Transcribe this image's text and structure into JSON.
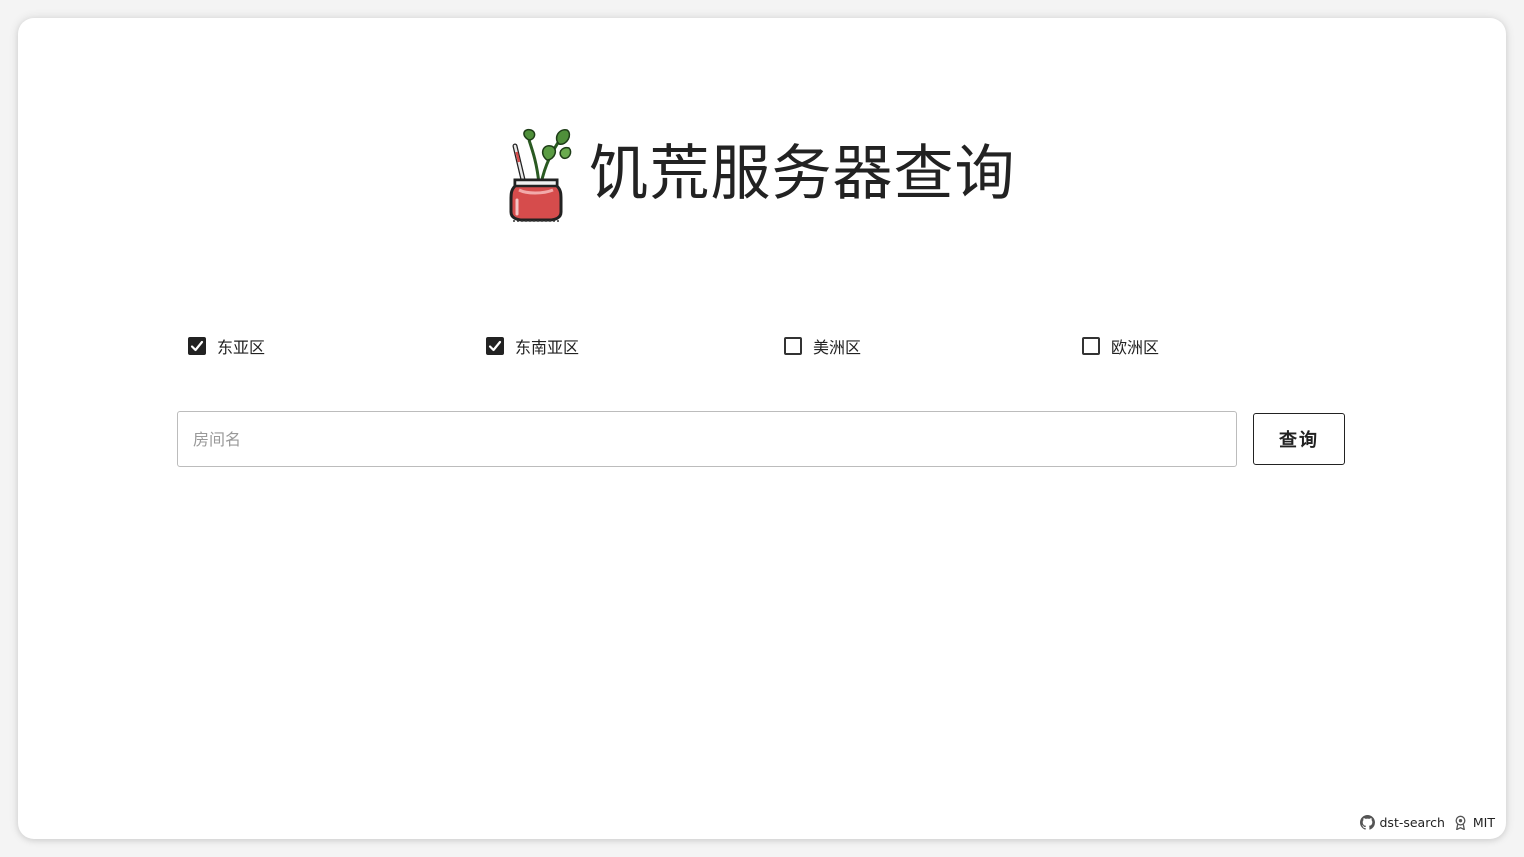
{
  "header": {
    "title": "饥荒服务器查询",
    "logo_icon": "juice-jar-logo-icon"
  },
  "regions": [
    {
      "label": "东亚区",
      "checked": true
    },
    {
      "label": "东南亚区",
      "checked": true
    },
    {
      "label": "美洲区",
      "checked": false
    },
    {
      "label": "欧洲区",
      "checked": false
    }
  ],
  "search": {
    "value": "",
    "placeholder": "房间名",
    "button_label": "查询"
  },
  "footer": {
    "repo_label": "dst-search",
    "repo_icon": "github-icon",
    "license_label": "MIT",
    "license_icon": "license-badge-icon"
  },
  "colors": {
    "checkbox_checked": "#222222",
    "jar_red": "#d64c4c",
    "leaf_green": "#4f8f3a"
  }
}
